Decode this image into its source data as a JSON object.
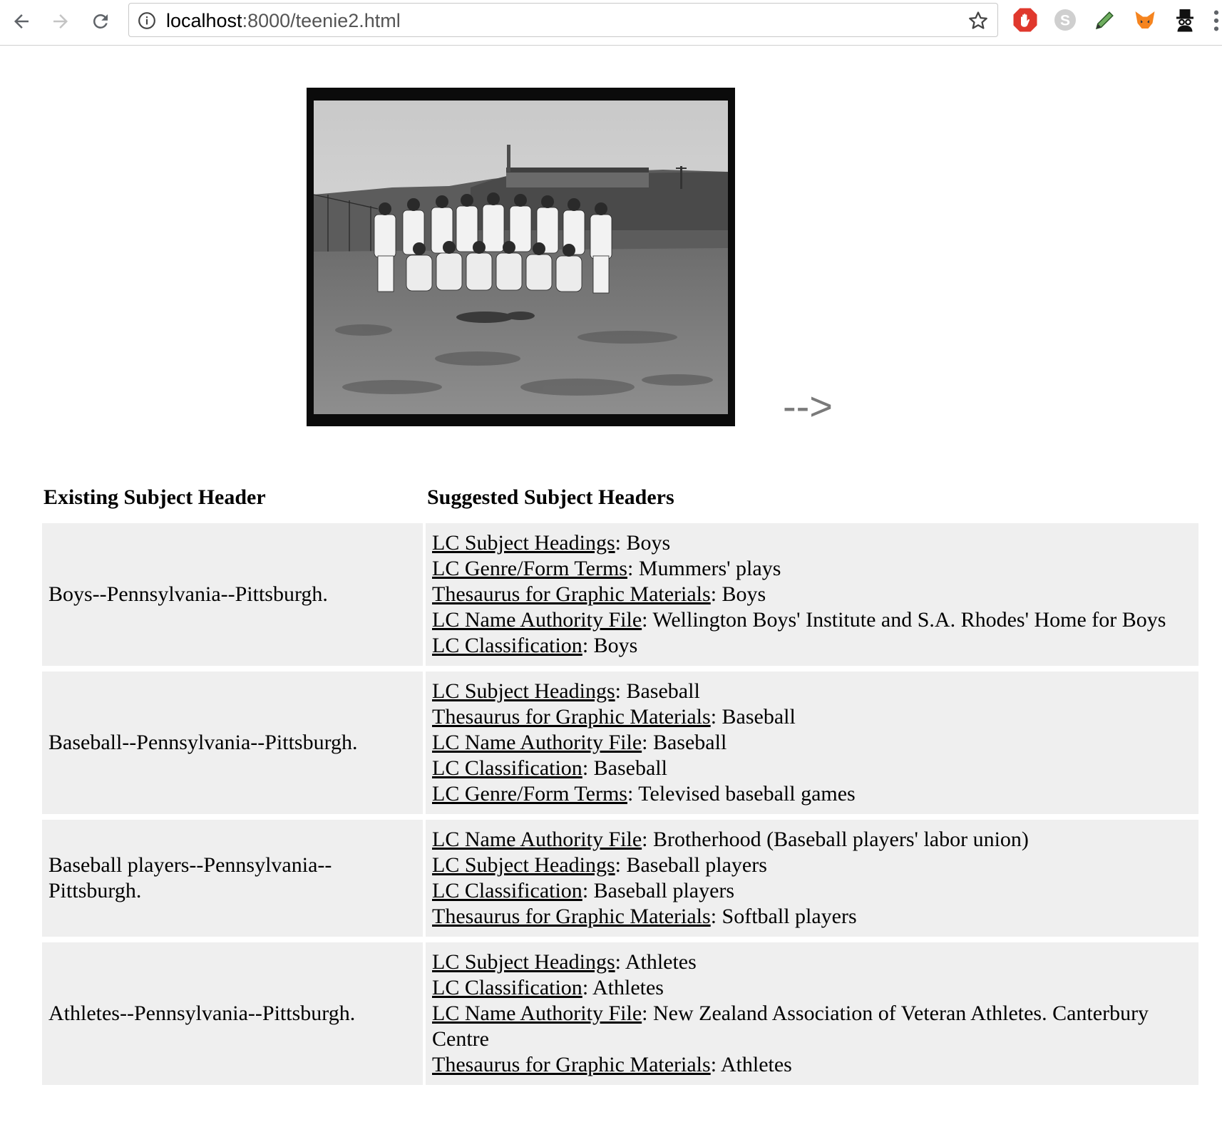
{
  "browser": {
    "url_host": "localhost",
    "url_rest": ":8000/teenie2.html"
  },
  "page": {
    "photo_alt": "",
    "arrow_text": "-->"
  },
  "table": {
    "headers": {
      "existing": "Existing Subject Header",
      "suggested": "Suggested Subject Headers"
    },
    "rows": [
      {
        "existing": "Boys--Pennsylvania--Pittsburgh.",
        "suggestions": [
          {
            "source": "LC Subject Headings",
            "term": ": Boys"
          },
          {
            "source": "LC Genre/Form Terms",
            "term": ": Mummers' plays"
          },
          {
            "source": "Thesaurus for Graphic Materials",
            "term": ": Boys"
          },
          {
            "source": "LC Name Authority File",
            "term": ": Wellington Boys' Institute and S.A. Rhodes' Home for Boys"
          },
          {
            "source": "LC Classification",
            "term": ": Boys"
          }
        ]
      },
      {
        "existing": "Baseball--Pennsylvania--Pittsburgh.",
        "suggestions": [
          {
            "source": "LC Subject Headings",
            "term": ": Baseball"
          },
          {
            "source": "Thesaurus for Graphic Materials",
            "term": ": Baseball"
          },
          {
            "source": "LC Name Authority File",
            "term": ": Baseball"
          },
          {
            "source": "LC Classification",
            "term": ": Baseball"
          },
          {
            "source": "LC Genre/Form Terms",
            "term": ": Televised baseball games"
          }
        ]
      },
      {
        "existing": "Baseball players--Pennsylvania--Pittsburgh.",
        "suggestions": [
          {
            "source": "LC Name Authority File",
            "term": ": Brotherhood (Baseball players' labor union)"
          },
          {
            "source": "LC Subject Headings",
            "term": ": Baseball players"
          },
          {
            "source": "LC Classification",
            "term": ": Baseball players"
          },
          {
            "source": "Thesaurus for Graphic Materials",
            "term": ": Softball players"
          }
        ]
      },
      {
        "existing": "Athletes--Pennsylvania--Pittsburgh.",
        "suggestions": [
          {
            "source": "LC Subject Headings",
            "term": ": Athletes"
          },
          {
            "source": "LC Classification",
            "term": ": Athletes"
          },
          {
            "source": "LC Name Authority File",
            "term": ": New Zealand Association of Veteran Athletes. Canterbury Centre"
          },
          {
            "source": "Thesaurus for Graphic Materials",
            "term": ": Athletes"
          }
        ]
      }
    ]
  },
  "icons": {
    "back": "back-arrow-icon",
    "forward": "forward-arrow-icon",
    "reload": "reload-icon",
    "info": "info-icon",
    "bookmark": "star-icon",
    "extensions": [
      "adblock-hand-icon",
      "skype-icon",
      "pencil-icon",
      "metamask-fox-icon",
      "spy-icon"
    ],
    "menu": "menu-dots-icon"
  },
  "colors": {
    "row_background": "#efefef",
    "arrow_text": "#7a7a7a",
    "adblock_red": "#e0382d"
  }
}
